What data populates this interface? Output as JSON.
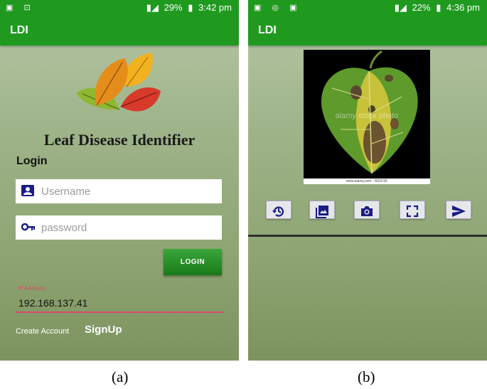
{
  "screen_a": {
    "status": {
      "time": "3:42 pm",
      "battery": "29%"
    },
    "app_title": "LDI",
    "title": "Leaf Disease Identifier",
    "login_heading": "Login",
    "username_placeholder": "Username",
    "password_placeholder": "password",
    "login_button": "LOGIN",
    "ip_label": "IP Address",
    "ip_value": "192.168.137.41",
    "create_account_text": "Create Account",
    "signup_link": "SignUp",
    "caption": "(a)"
  },
  "screen_b": {
    "status": {
      "time": "4:36 pm",
      "battery": "22%"
    },
    "app_title": "LDI",
    "toolbar": [
      {
        "icon": "history-icon"
      },
      {
        "icon": "gallery-icon"
      },
      {
        "icon": "camera-icon"
      },
      {
        "icon": "fullscreen-icon"
      },
      {
        "icon": "send-icon"
      }
    ],
    "photo_watermark": "alamy stock photo",
    "photo_footer": "www.alamy.com - R01F1K",
    "caption": "(b)"
  },
  "colors": {
    "app_bar": "#1f9a1f",
    "login_button": "#2a8f2a",
    "ip_accent": "#d84a6a",
    "icon_blue": "#1b1c86"
  }
}
